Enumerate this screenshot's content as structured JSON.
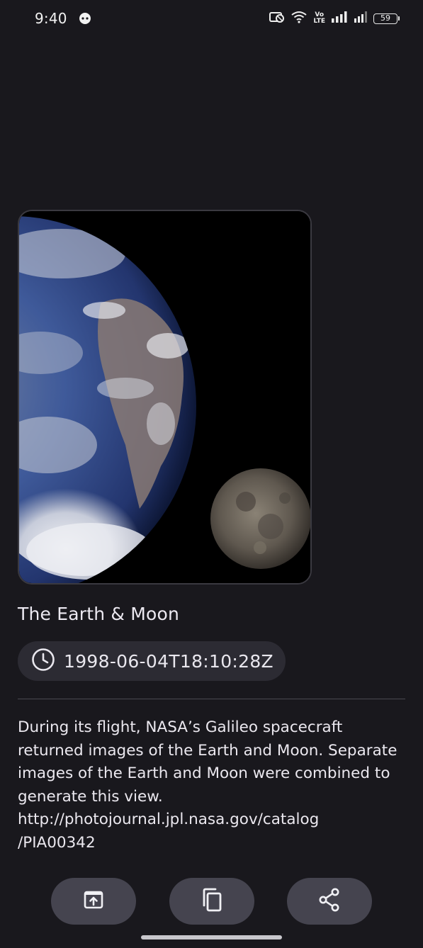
{
  "status_bar": {
    "time": "9:40",
    "volte": "Vo\nLTE",
    "battery_level": "59",
    "icons": [
      "ghost-notification-icon",
      "no-sim-icon",
      "wifi-icon",
      "volte-icon",
      "signal-icon",
      "signal-icon",
      "battery-icon"
    ]
  },
  "apod": {
    "image_subject": "earth-and-moon-photo",
    "title": "The Earth & Moon",
    "date": "1998-06-04T18:10:28Z",
    "description": "During its flight, NASA’s Galileo spacecraft returned images of the Earth and Moon. Separate images of the Earth and Moon were combined to generate this view. http://photojournal.jpl.nasa.gov/catalog\n/PIA00342"
  },
  "actions": {
    "icons": [
      "open-external-icon",
      "copy-icon",
      "share-icon"
    ]
  },
  "colors": {
    "background": "#19181d",
    "chip": "#2c2b33",
    "button": "#45444f",
    "text": "#ebe9f0"
  }
}
